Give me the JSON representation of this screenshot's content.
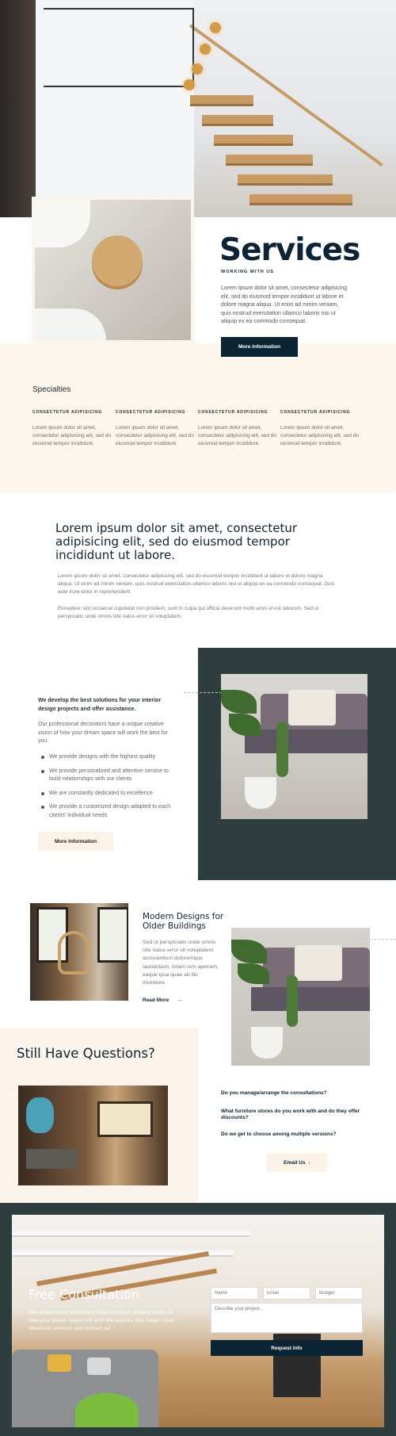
{
  "services": {
    "title": "Services",
    "subtitle": "WORKING WITH US",
    "body": "Lorem ipsum dolor sit amet, consectetur adipisicing elit, sed do eiusmod tempor incididunt ut labore et dolore magna aliqua. Ut enim ad minim veniam, quis nostrud exercitation ullamco laboris nisi ut aliquip ex ea commodo consequat.",
    "button": "More Information"
  },
  "specialties": {
    "title": "Specialties",
    "items": [
      {
        "heading": "CONSECTETUR ADIPISICING",
        "text": "Lorem ipsum dolor sit amet, consectetur adipisicing elit, sed do eiusmod tempor incididunt."
      },
      {
        "heading": "CONSECTETUR ADIPISICING",
        "text": "Lorem ipsum dolor sit amet, consectetur adipisicing elit, sed do eiusmod tempor incididunt."
      },
      {
        "heading": "CONSECTETUR ADIPISICING",
        "text": "Lorem ipsum dolor sit amet, consectetur adipisicing elit, sed do eiusmod tempor incididunt."
      },
      {
        "heading": "CONSECTETUR ADIPISICING",
        "text": "Lorem ipsum dolor sit amet, consectetur adipisicing elit, sed do eiusmod tempor incididunt."
      }
    ]
  },
  "lead": {
    "heading": "Lorem ipsum dolor sit amet, consectetur adipisicing elit, sed do eiusmod tempor incididunt ut labore.",
    "para1": "Lorem ipsum dolor sit amet, consectetur adipisicing elit, sed do eiusmod tempor incididunt ut labore et dolore magna aliqua. Ut enim ad minim veniam, quis nostrud exercitation ullamco laboris nisi ut aliquip ex ea commodo consequat. Duis aute irure dolor in reprehenderit.",
    "para2": "Excepteur sint occaecat cupidatat non proident, sunt in culpa qui officia deserunt mollit anim id est laborum. Sed ut perspiciatis unde omnis iste natus error sit voluptatem."
  },
  "develop": {
    "heading": "We develop the best solutions for your interior design projects and offer assistance.",
    "body": "Our professional decorators have a unique creative vision of how your dream space will work the best for you.",
    "list": [
      "We provide designs with the highest quality",
      "We provide personalized and attentive service to build relationships with our clients",
      "We are constantly dedicated to excellence",
      "We provide a customized design adapted to each clients' individual needs"
    ],
    "button": "More Information"
  },
  "modern": {
    "title": "Modern Designs for Older Buildings",
    "body": "Sed ut perspiciatis unde omnis iste natus error sit voluptatem accusantium doloremque laudantium, totam rem aperiam, eaque ipsa quae ab illo inventore.",
    "link": "Read More",
    "link_arrow": "→"
  },
  "questions": {
    "title": "Still Have Questions?",
    "faqs": [
      "Do you manage/arrange the consultations?",
      "What furniture stores do you work with and do they offer discounts?",
      "Do we get to choose among multiple versions?"
    ],
    "button": "Email Us",
    "button_icon": "↓"
  },
  "consultation": {
    "title": "Free Consultation",
    "body": "Our professional decorators have a unique creative vision of how your dream space will work the best for you. Learn more about our services and contact us!",
    "name_placeholder": "Name",
    "email_placeholder": "Email",
    "budget_placeholder": "Budget",
    "project_placeholder": "Describe your project...",
    "button": "Request Info"
  },
  "colors": {
    "navy": "#0b2433",
    "cream": "#fcf6ec",
    "slate": "#2e3e3f"
  }
}
